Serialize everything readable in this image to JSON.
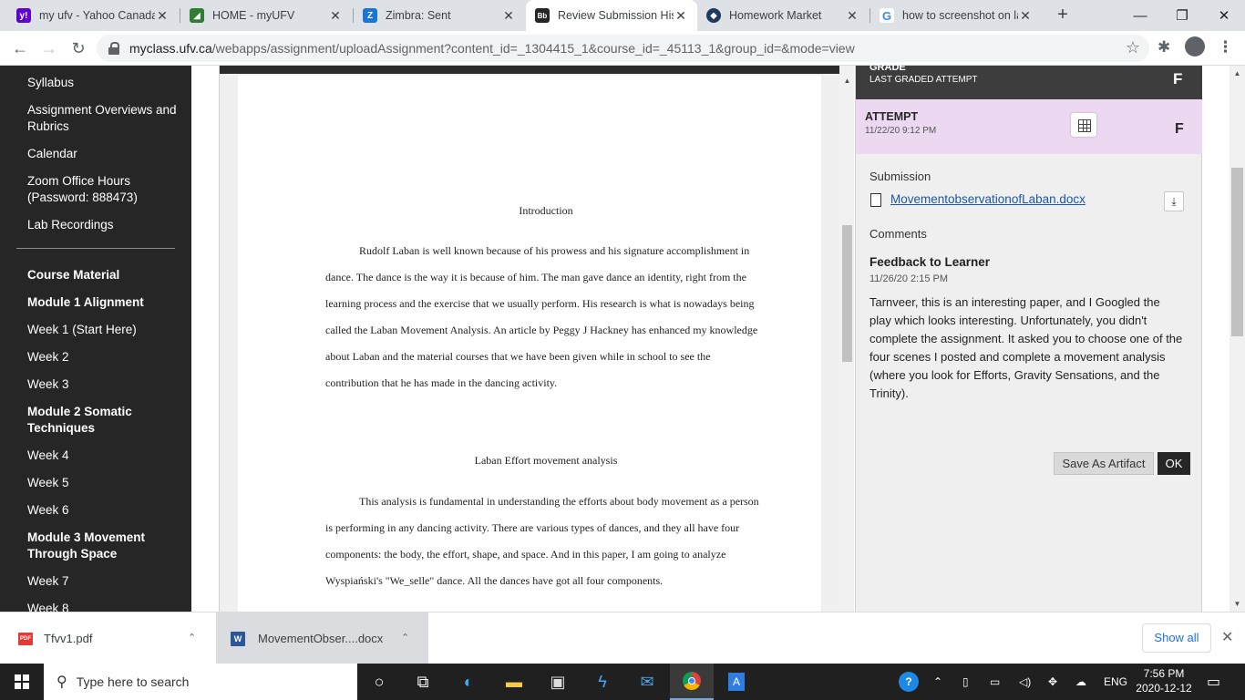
{
  "browser": {
    "tabs": [
      {
        "label": "my ufv - Yahoo Canada",
        "icon": "yahoo-icon",
        "color": "#5f01d1"
      },
      {
        "label": "HOME - myUFV",
        "icon": "ufv-icon",
        "color": "#2e7d32"
      },
      {
        "label": "Zimbra: Sent",
        "icon": "zimbra-icon",
        "color": "#1976d2"
      },
      {
        "label": "Review Submission Hist",
        "icon": "blackboard-icon",
        "color": "#262626"
      },
      {
        "label": "Homework Market",
        "icon": "homework-market-icon",
        "color": "#1e3a5f"
      },
      {
        "label": "how to screenshot on la",
        "icon": "google-icon",
        "color": "#4285f4"
      }
    ],
    "url_host": "myclass.ufv.ca",
    "url_path": "/webapps/assignment/uploadAssignment?content_id=_1304415_1&course_id=_45113_1&group_id=&mode=view"
  },
  "sidebar": {
    "items": [
      {
        "label": "Syllabus",
        "bold": false
      },
      {
        "label": "Assignment Overviews and Rubrics",
        "bold": false
      },
      {
        "label": "Calendar",
        "bold": false
      },
      {
        "label": "Zoom Office Hours (Password: 888473)",
        "bold": false
      },
      {
        "label": "Lab Recordings",
        "bold": false
      },
      {
        "label": "Course Material",
        "bold": true
      },
      {
        "label": "Module 1 Alignment",
        "bold": true
      },
      {
        "label": "Week 1 (Start Here)",
        "bold": false
      },
      {
        "label": "Week 2",
        "bold": false
      },
      {
        "label": "Week 3",
        "bold": false
      },
      {
        "label": "Module 2 Somatic Techniques",
        "bold": true
      },
      {
        "label": "Week 4",
        "bold": false
      },
      {
        "label": "Week 5",
        "bold": false
      },
      {
        "label": "Week 6",
        "bold": false
      },
      {
        "label": "Module 3 Movement Through Space",
        "bold": true
      },
      {
        "label": "Week 7",
        "bold": false
      },
      {
        "label": "Week 8",
        "bold": false
      }
    ]
  },
  "document": {
    "heading1": "Introduction",
    "para1": [
      "Rudolf Laban is well known because of his prowess and his signature accomplishment in",
      "dance. The dance is the way it is because of him. The man gave dance an identity, right from the",
      "learning process and the exercise that we usually perform. His research is what is nowadays being",
      "called the Laban Movement Analysis. An article by Peggy J Hackney has enhanced my knowledge",
      "about Laban and the material courses that we have been given while in school to see the",
      "contribution that he has made in the dancing activity."
    ],
    "heading2": "Laban Effort movement analysis",
    "para2": [
      "This analysis is fundamental in understanding the efforts about body movement as a person",
      "is performing in any dancing activity. There are various types of dances, and they all have four",
      "components: the body, the effort, shape, and space. And in this paper, I am going to analyze",
      "Wyspiański's \"We_selle\" dance. All the dances have got all four components."
    ]
  },
  "panel": {
    "grade_title": "GRADE",
    "grade_sub": "LAST GRADED ATTEMPT",
    "grade_letter": "F",
    "attempt_title": "ATTEMPT",
    "attempt_date": "11/22/20 9:12 PM",
    "attempt_letter": "F",
    "submission_label": "Submission",
    "file_name": "MovementobservationofLaban.docx",
    "comments_label": "Comments",
    "feedback_title": "Feedback to Learner",
    "feedback_date": "11/26/20 2:15 PM",
    "feedback_text": "Tarnveer, this is an interesting paper, and I Googled the play which looks interesting. Unfortunately, you didn't complete the assignment. It asked you to choose one of the four scenes I posted and complete a movement analysis (where you look for Efforts, Gravity Sensations, and the Trinity).",
    "save_artifact": "Save As Artifact",
    "ok": "OK"
  },
  "downloads": {
    "items": [
      {
        "name": "Tfvv1.pdf",
        "icon": "pdf-icon"
      },
      {
        "name": "MovementObser....docx",
        "icon": "word-icon"
      }
    ],
    "show_all": "Show all"
  },
  "taskbar": {
    "search_placeholder": "Type here to search",
    "language": "ENG",
    "time": "7:56 PM",
    "date": "2020-12-12"
  }
}
